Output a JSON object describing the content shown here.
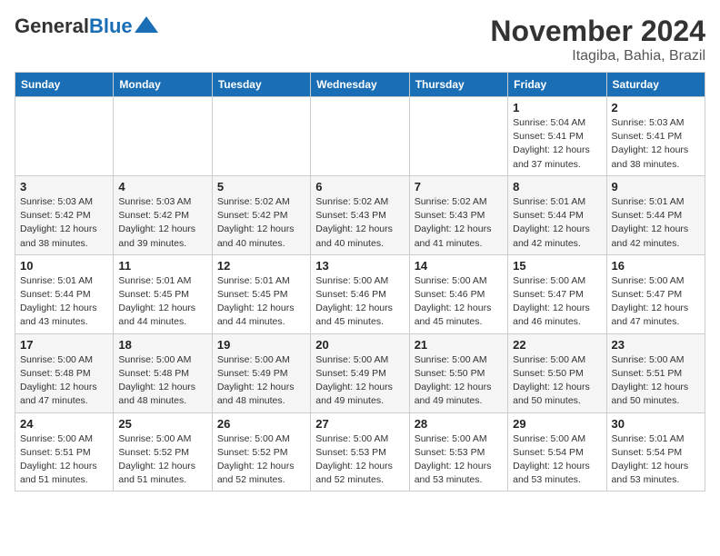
{
  "header": {
    "logo_general": "General",
    "logo_blue": "Blue",
    "month_title": "November 2024",
    "location": "Itagiba, Bahia, Brazil"
  },
  "weekdays": [
    "Sunday",
    "Monday",
    "Tuesday",
    "Wednesday",
    "Thursday",
    "Friday",
    "Saturday"
  ],
  "weeks": [
    [
      {
        "day": "",
        "info": ""
      },
      {
        "day": "",
        "info": ""
      },
      {
        "day": "",
        "info": ""
      },
      {
        "day": "",
        "info": ""
      },
      {
        "day": "",
        "info": ""
      },
      {
        "day": "1",
        "info": "Sunrise: 5:04 AM\nSunset: 5:41 PM\nDaylight: 12 hours\nand 37 minutes."
      },
      {
        "day": "2",
        "info": "Sunrise: 5:03 AM\nSunset: 5:41 PM\nDaylight: 12 hours\nand 38 minutes."
      }
    ],
    [
      {
        "day": "3",
        "info": "Sunrise: 5:03 AM\nSunset: 5:42 PM\nDaylight: 12 hours\nand 38 minutes."
      },
      {
        "day": "4",
        "info": "Sunrise: 5:03 AM\nSunset: 5:42 PM\nDaylight: 12 hours\nand 39 minutes."
      },
      {
        "day": "5",
        "info": "Sunrise: 5:02 AM\nSunset: 5:42 PM\nDaylight: 12 hours\nand 40 minutes."
      },
      {
        "day": "6",
        "info": "Sunrise: 5:02 AM\nSunset: 5:43 PM\nDaylight: 12 hours\nand 40 minutes."
      },
      {
        "day": "7",
        "info": "Sunrise: 5:02 AM\nSunset: 5:43 PM\nDaylight: 12 hours\nand 41 minutes."
      },
      {
        "day": "8",
        "info": "Sunrise: 5:01 AM\nSunset: 5:44 PM\nDaylight: 12 hours\nand 42 minutes."
      },
      {
        "day": "9",
        "info": "Sunrise: 5:01 AM\nSunset: 5:44 PM\nDaylight: 12 hours\nand 42 minutes."
      }
    ],
    [
      {
        "day": "10",
        "info": "Sunrise: 5:01 AM\nSunset: 5:44 PM\nDaylight: 12 hours\nand 43 minutes."
      },
      {
        "day": "11",
        "info": "Sunrise: 5:01 AM\nSunset: 5:45 PM\nDaylight: 12 hours\nand 44 minutes."
      },
      {
        "day": "12",
        "info": "Sunrise: 5:01 AM\nSunset: 5:45 PM\nDaylight: 12 hours\nand 44 minutes."
      },
      {
        "day": "13",
        "info": "Sunrise: 5:00 AM\nSunset: 5:46 PM\nDaylight: 12 hours\nand 45 minutes."
      },
      {
        "day": "14",
        "info": "Sunrise: 5:00 AM\nSunset: 5:46 PM\nDaylight: 12 hours\nand 45 minutes."
      },
      {
        "day": "15",
        "info": "Sunrise: 5:00 AM\nSunset: 5:47 PM\nDaylight: 12 hours\nand 46 minutes."
      },
      {
        "day": "16",
        "info": "Sunrise: 5:00 AM\nSunset: 5:47 PM\nDaylight: 12 hours\nand 47 minutes."
      }
    ],
    [
      {
        "day": "17",
        "info": "Sunrise: 5:00 AM\nSunset: 5:48 PM\nDaylight: 12 hours\nand 47 minutes."
      },
      {
        "day": "18",
        "info": "Sunrise: 5:00 AM\nSunset: 5:48 PM\nDaylight: 12 hours\nand 48 minutes."
      },
      {
        "day": "19",
        "info": "Sunrise: 5:00 AM\nSunset: 5:49 PM\nDaylight: 12 hours\nand 48 minutes."
      },
      {
        "day": "20",
        "info": "Sunrise: 5:00 AM\nSunset: 5:49 PM\nDaylight: 12 hours\nand 49 minutes."
      },
      {
        "day": "21",
        "info": "Sunrise: 5:00 AM\nSunset: 5:50 PM\nDaylight: 12 hours\nand 49 minutes."
      },
      {
        "day": "22",
        "info": "Sunrise: 5:00 AM\nSunset: 5:50 PM\nDaylight: 12 hours\nand 50 minutes."
      },
      {
        "day": "23",
        "info": "Sunrise: 5:00 AM\nSunset: 5:51 PM\nDaylight: 12 hours\nand 50 minutes."
      }
    ],
    [
      {
        "day": "24",
        "info": "Sunrise: 5:00 AM\nSunset: 5:51 PM\nDaylight: 12 hours\nand 51 minutes."
      },
      {
        "day": "25",
        "info": "Sunrise: 5:00 AM\nSunset: 5:52 PM\nDaylight: 12 hours\nand 51 minutes."
      },
      {
        "day": "26",
        "info": "Sunrise: 5:00 AM\nSunset: 5:52 PM\nDaylight: 12 hours\nand 52 minutes."
      },
      {
        "day": "27",
        "info": "Sunrise: 5:00 AM\nSunset: 5:53 PM\nDaylight: 12 hours\nand 52 minutes."
      },
      {
        "day": "28",
        "info": "Sunrise: 5:00 AM\nSunset: 5:53 PM\nDaylight: 12 hours\nand 53 minutes."
      },
      {
        "day": "29",
        "info": "Sunrise: 5:00 AM\nSunset: 5:54 PM\nDaylight: 12 hours\nand 53 minutes."
      },
      {
        "day": "30",
        "info": "Sunrise: 5:01 AM\nSunset: 5:54 PM\nDaylight: 12 hours\nand 53 minutes."
      }
    ]
  ]
}
